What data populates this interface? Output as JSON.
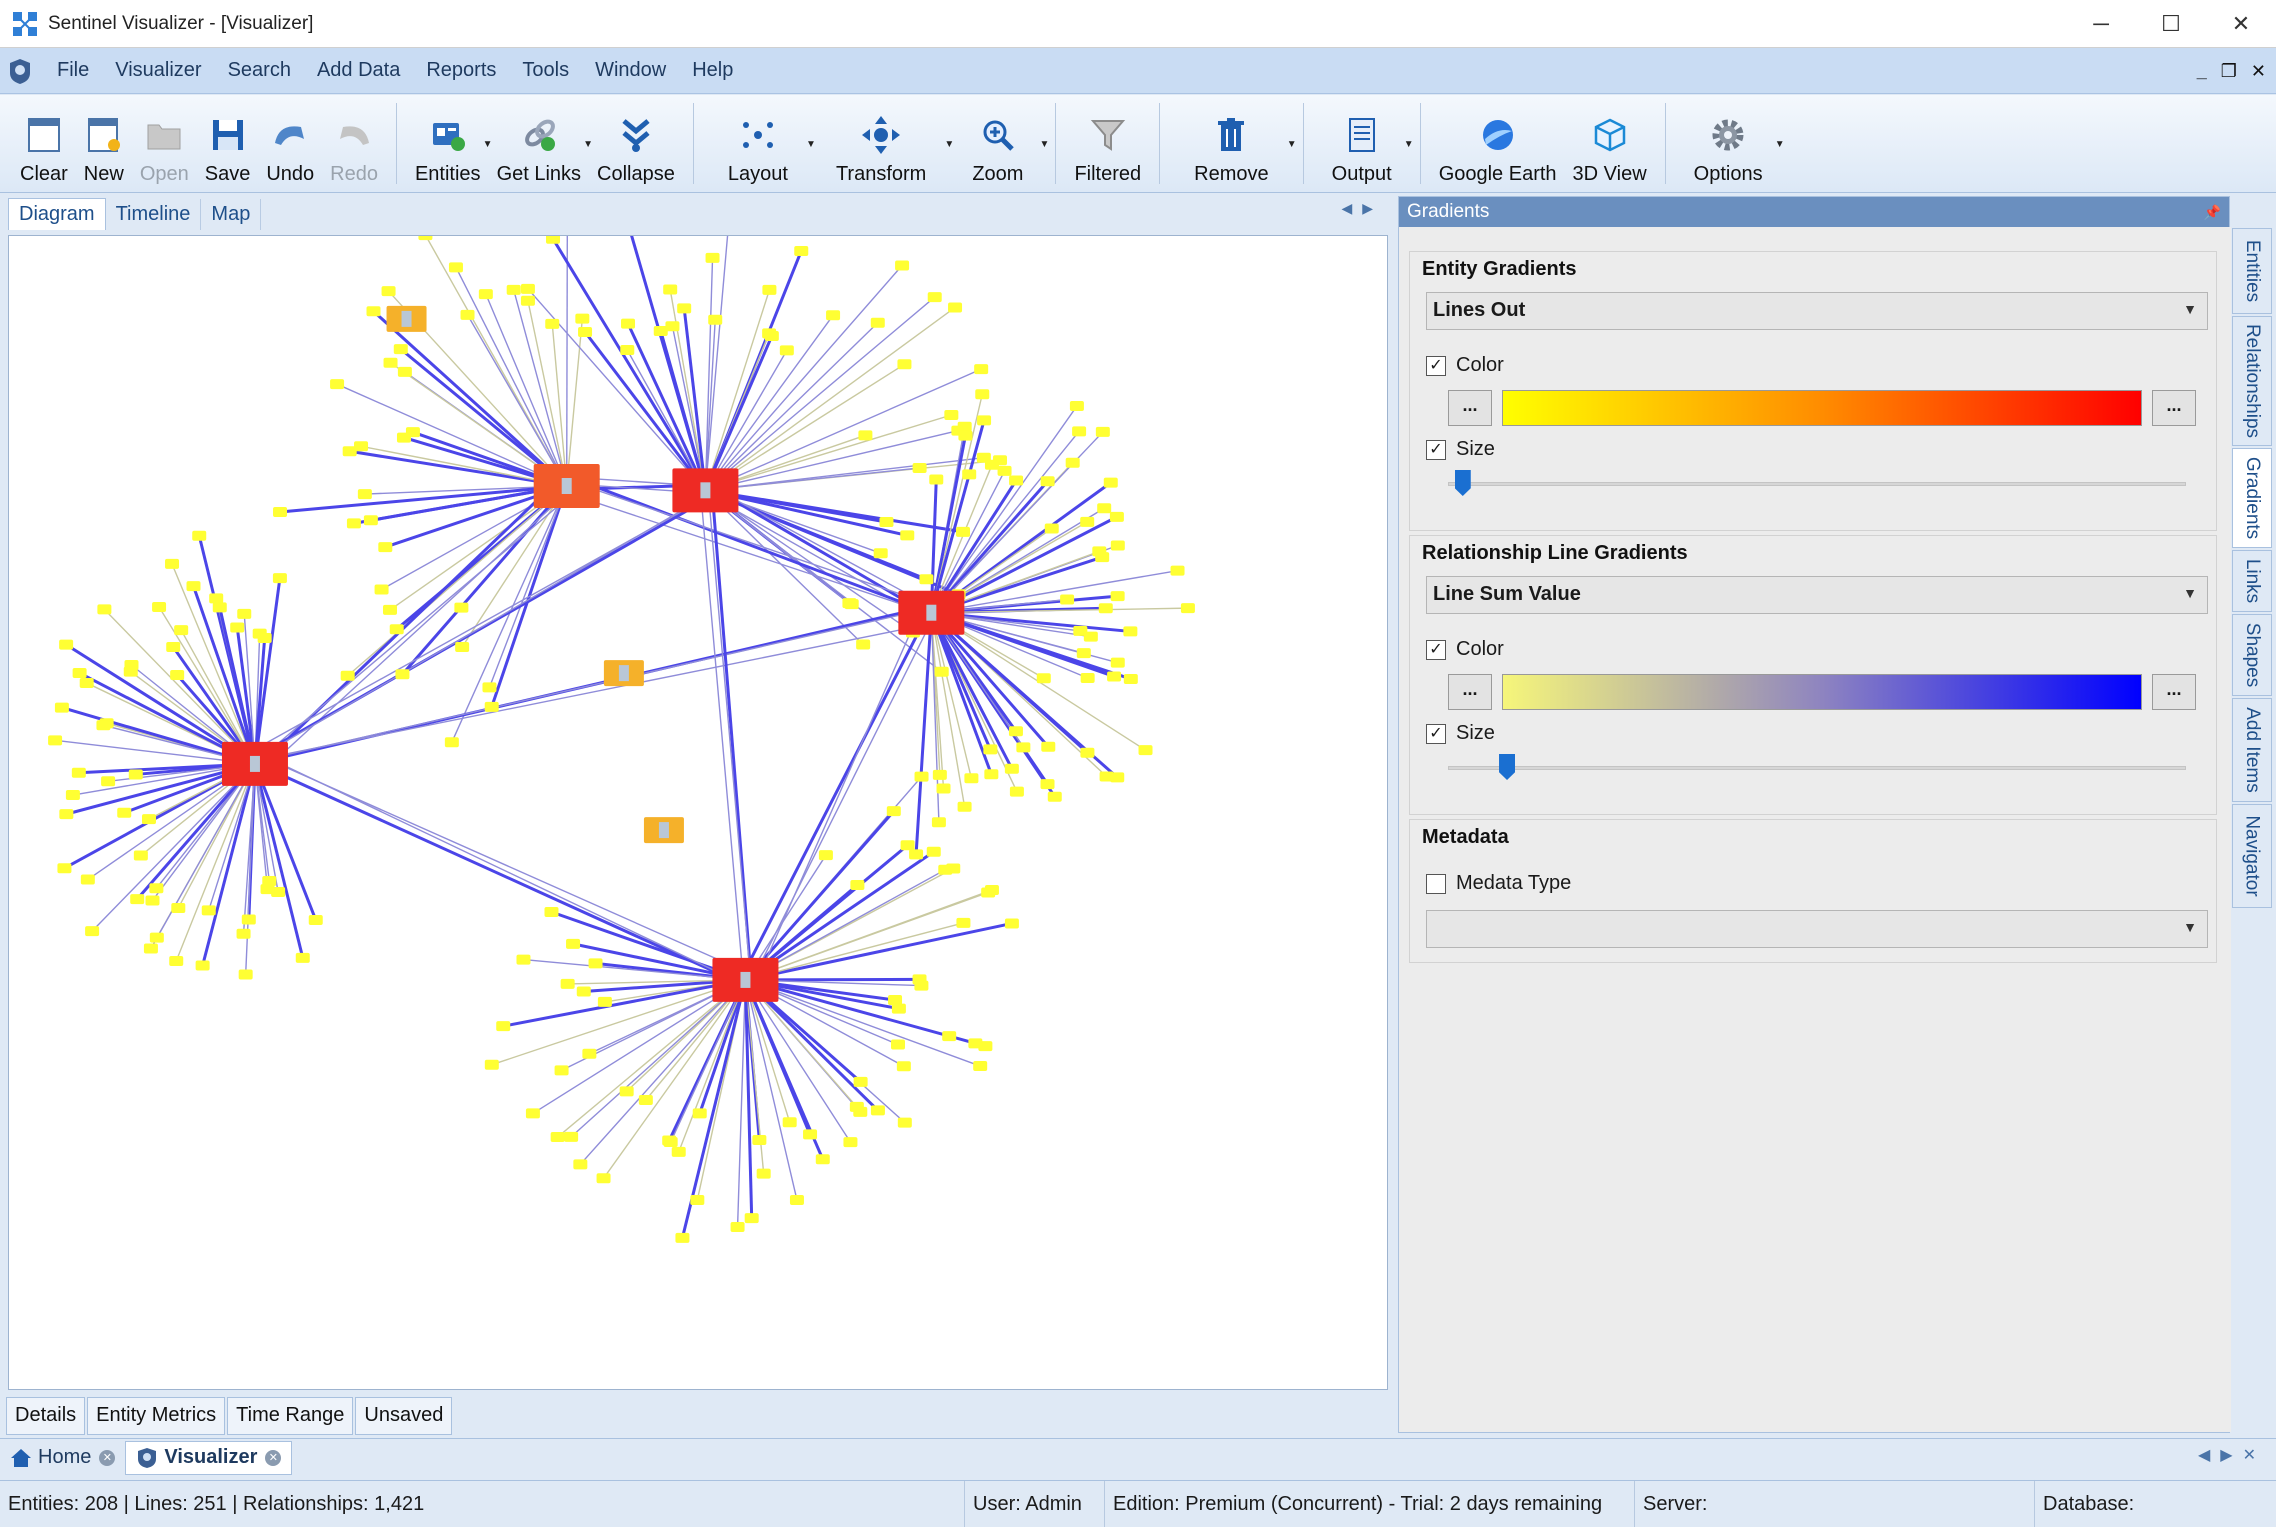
{
  "window": {
    "title": "Sentinel Visualizer - [Visualizer]",
    "controls": {
      "minimize": "─",
      "maximize": "☐",
      "close": "✕"
    }
  },
  "menu": {
    "items": [
      "File",
      "Visualizer",
      "Search",
      "Add Data",
      "Reports",
      "Tools",
      "Window",
      "Help"
    ],
    "mdi_controls": {
      "minimize": "_",
      "restore": "❐",
      "close": "✕"
    }
  },
  "toolbar": {
    "buttons": [
      {
        "label": "Clear",
        "icon": "clear-icon",
        "enabled": true,
        "dropdown": false
      },
      {
        "label": "New",
        "icon": "new-icon",
        "enabled": true,
        "dropdown": false
      },
      {
        "label": "Open",
        "icon": "open-folder-icon",
        "enabled": false,
        "dropdown": false
      },
      {
        "label": "Save",
        "icon": "save-icon",
        "enabled": true,
        "dropdown": false
      },
      {
        "label": "Undo",
        "icon": "undo-icon",
        "enabled": true,
        "dropdown": false
      },
      {
        "label": "Redo",
        "icon": "redo-icon",
        "enabled": false,
        "dropdown": false
      },
      {
        "label": "Entities",
        "icon": "entities-icon",
        "enabled": true,
        "dropdown": true
      },
      {
        "label": "Get Links",
        "icon": "get-links-icon",
        "enabled": true,
        "dropdown": true
      },
      {
        "label": "Collapse",
        "icon": "collapse-icon",
        "enabled": true,
        "dropdown": false
      },
      {
        "label": "Layout",
        "icon": "layout-icon",
        "enabled": true,
        "dropdown": true
      },
      {
        "label": "Transform",
        "icon": "transform-icon",
        "enabled": true,
        "dropdown": true
      },
      {
        "label": "Zoom",
        "icon": "zoom-icon",
        "enabled": true,
        "dropdown": true
      },
      {
        "label": "Filtered",
        "icon": "filter-icon",
        "enabled": true,
        "dropdown": false
      },
      {
        "label": "Remove",
        "icon": "trash-icon",
        "enabled": true,
        "dropdown": true
      },
      {
        "label": "Output",
        "icon": "output-icon",
        "enabled": true,
        "dropdown": true
      },
      {
        "label": "Google Earth",
        "icon": "google-earth-icon",
        "enabled": true,
        "dropdown": false
      },
      {
        "label": "3D View",
        "icon": "cube-icon",
        "enabled": true,
        "dropdown": false
      },
      {
        "label": "Options",
        "icon": "gear-icon",
        "enabled": true,
        "dropdown": true
      }
    ]
  },
  "view_tabs": {
    "items": [
      "Diagram",
      "Timeline",
      "Map"
    ],
    "active": "Diagram"
  },
  "bottom_tabs": [
    "Details",
    "Entity Metrics",
    "Time Range",
    "Unsaved"
  ],
  "gradients_panel": {
    "title": "Gradients",
    "entity": {
      "heading": "Entity Gradients",
      "mode": "Lines Out",
      "color_label": "Color",
      "color_checked": true,
      "size_label": "Size",
      "size_checked": true,
      "gradient_from": "#ffff00",
      "gradient_mid": "#ff8c00",
      "gradient_to": "#ff0000",
      "size_level": 0.02,
      "button_label": "..."
    },
    "relationship": {
      "heading": "Relationship Line Gradients",
      "mode": "Line Sum Value",
      "color_label": "Color",
      "color_checked": true,
      "size_label": "Size",
      "size_checked": true,
      "gradient_from": "#f6f67a",
      "gradient_mid": "#8e84c0",
      "gradient_to": "#0000ff",
      "size_level": 0.08,
      "button_label": "..."
    },
    "metadata": {
      "heading": "Metadata",
      "checkbox_label": "Medata Type",
      "checked": false,
      "value": ""
    }
  },
  "side_tabs": [
    "Entities",
    "Relationships",
    "Gradients",
    "Links",
    "Shapes",
    "Add Items",
    "Navigator"
  ],
  "side_tab_active": "Gradients",
  "document_tabs": [
    {
      "label": "Home",
      "icon": "home-icon",
      "active": false
    },
    {
      "label": "Visualizer",
      "icon": "visualizer-icon",
      "active": true
    }
  ],
  "status": {
    "counts": "Entities: 208 | Lines: 251 | Relationships: 1,421",
    "user": "User:  Admin",
    "edition": "Edition: Premium (Concurrent) - Trial: 2 days remaining",
    "server": "Server:",
    "database": "Database:"
  },
  "colors": {
    "hub_node": "#ee2a24",
    "hub_node_alt": "#f25a2a",
    "mid_node": "#f5b12a",
    "leaf_node": "#ffff33",
    "edge_strong": "#4b45e8",
    "edge_medium": "#8f8cd9",
    "edge_weak": "#c9c9a0"
  }
}
